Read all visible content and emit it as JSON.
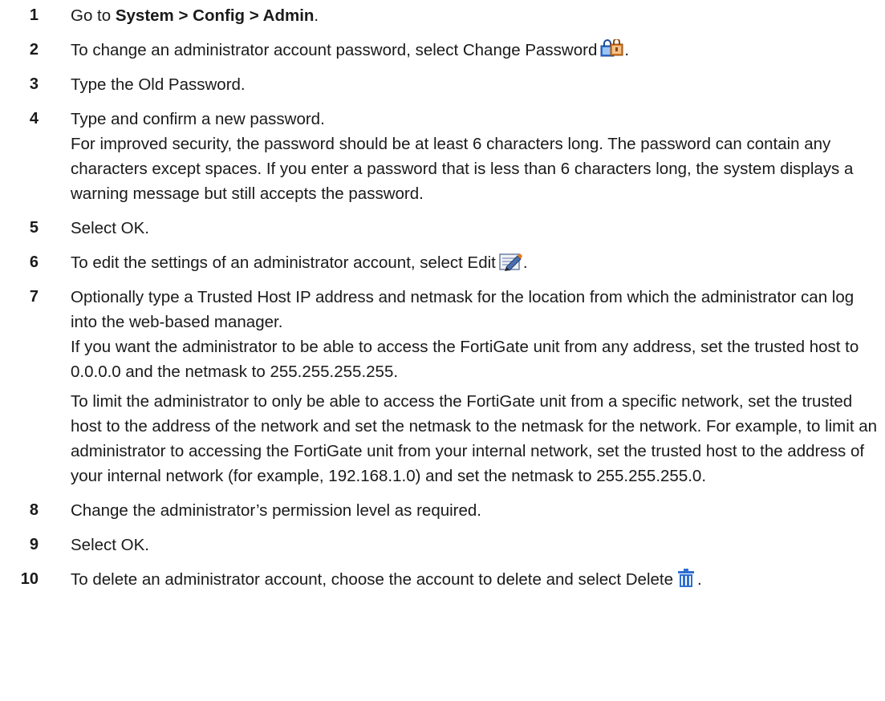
{
  "steps": [
    {
      "number": "1",
      "prefix": "Go to ",
      "bold_path": "System > Config > Admin",
      "suffix": "."
    },
    {
      "number": "2",
      "text": "To change an administrator account password, select Change Password",
      "suffix": ".",
      "icon": "change-password-icon"
    },
    {
      "number": "3",
      "text": "Type the Old Password."
    },
    {
      "number": "4",
      "text": "Type and confirm a new password.",
      "note": "For improved security, the password should be at least 6 characters long. The password can contain any characters except spaces. If you enter a password that is less than 6 characters long, the system displays a warning message but still accepts the password."
    },
    {
      "number": "5",
      "text": "Select OK."
    },
    {
      "number": "6",
      "text": "To edit the settings of an administrator account, select Edit",
      "suffix": ".",
      "icon": "edit-icon"
    },
    {
      "number": "7",
      "text": "Optionally type a Trusted Host IP address and netmask for the location from which the administrator can log into the web-based manager.",
      "note1": "If you want the administrator to be able to access the FortiGate unit from any address, set the trusted host to 0.0.0.0 and the netmask to 255.255.255.255.",
      "note2": "To limit the administrator to only be able to access the FortiGate unit from a specific network, set the trusted host to the address of the network and set the netmask to the netmask for the network. For example, to limit an administrator to accessing the FortiGate unit from your internal network, set the trusted host to the address of your internal network (for example, 192.168.1.0) and set the netmask to 255.255.255.0."
    },
    {
      "number": "8",
      "text": "Change the administrator’s permission level as required."
    },
    {
      "number": "9",
      "text": "Select OK."
    },
    {
      "number": "10",
      "text": "To delete an administrator account, choose the account to delete and select Delete",
      "suffix": ".",
      "icon": "delete-icon"
    }
  ],
  "colors": {
    "text": "#1a1a1a",
    "icon_blue": "#2f6fd0",
    "icon_orange": "#e07a1f"
  }
}
